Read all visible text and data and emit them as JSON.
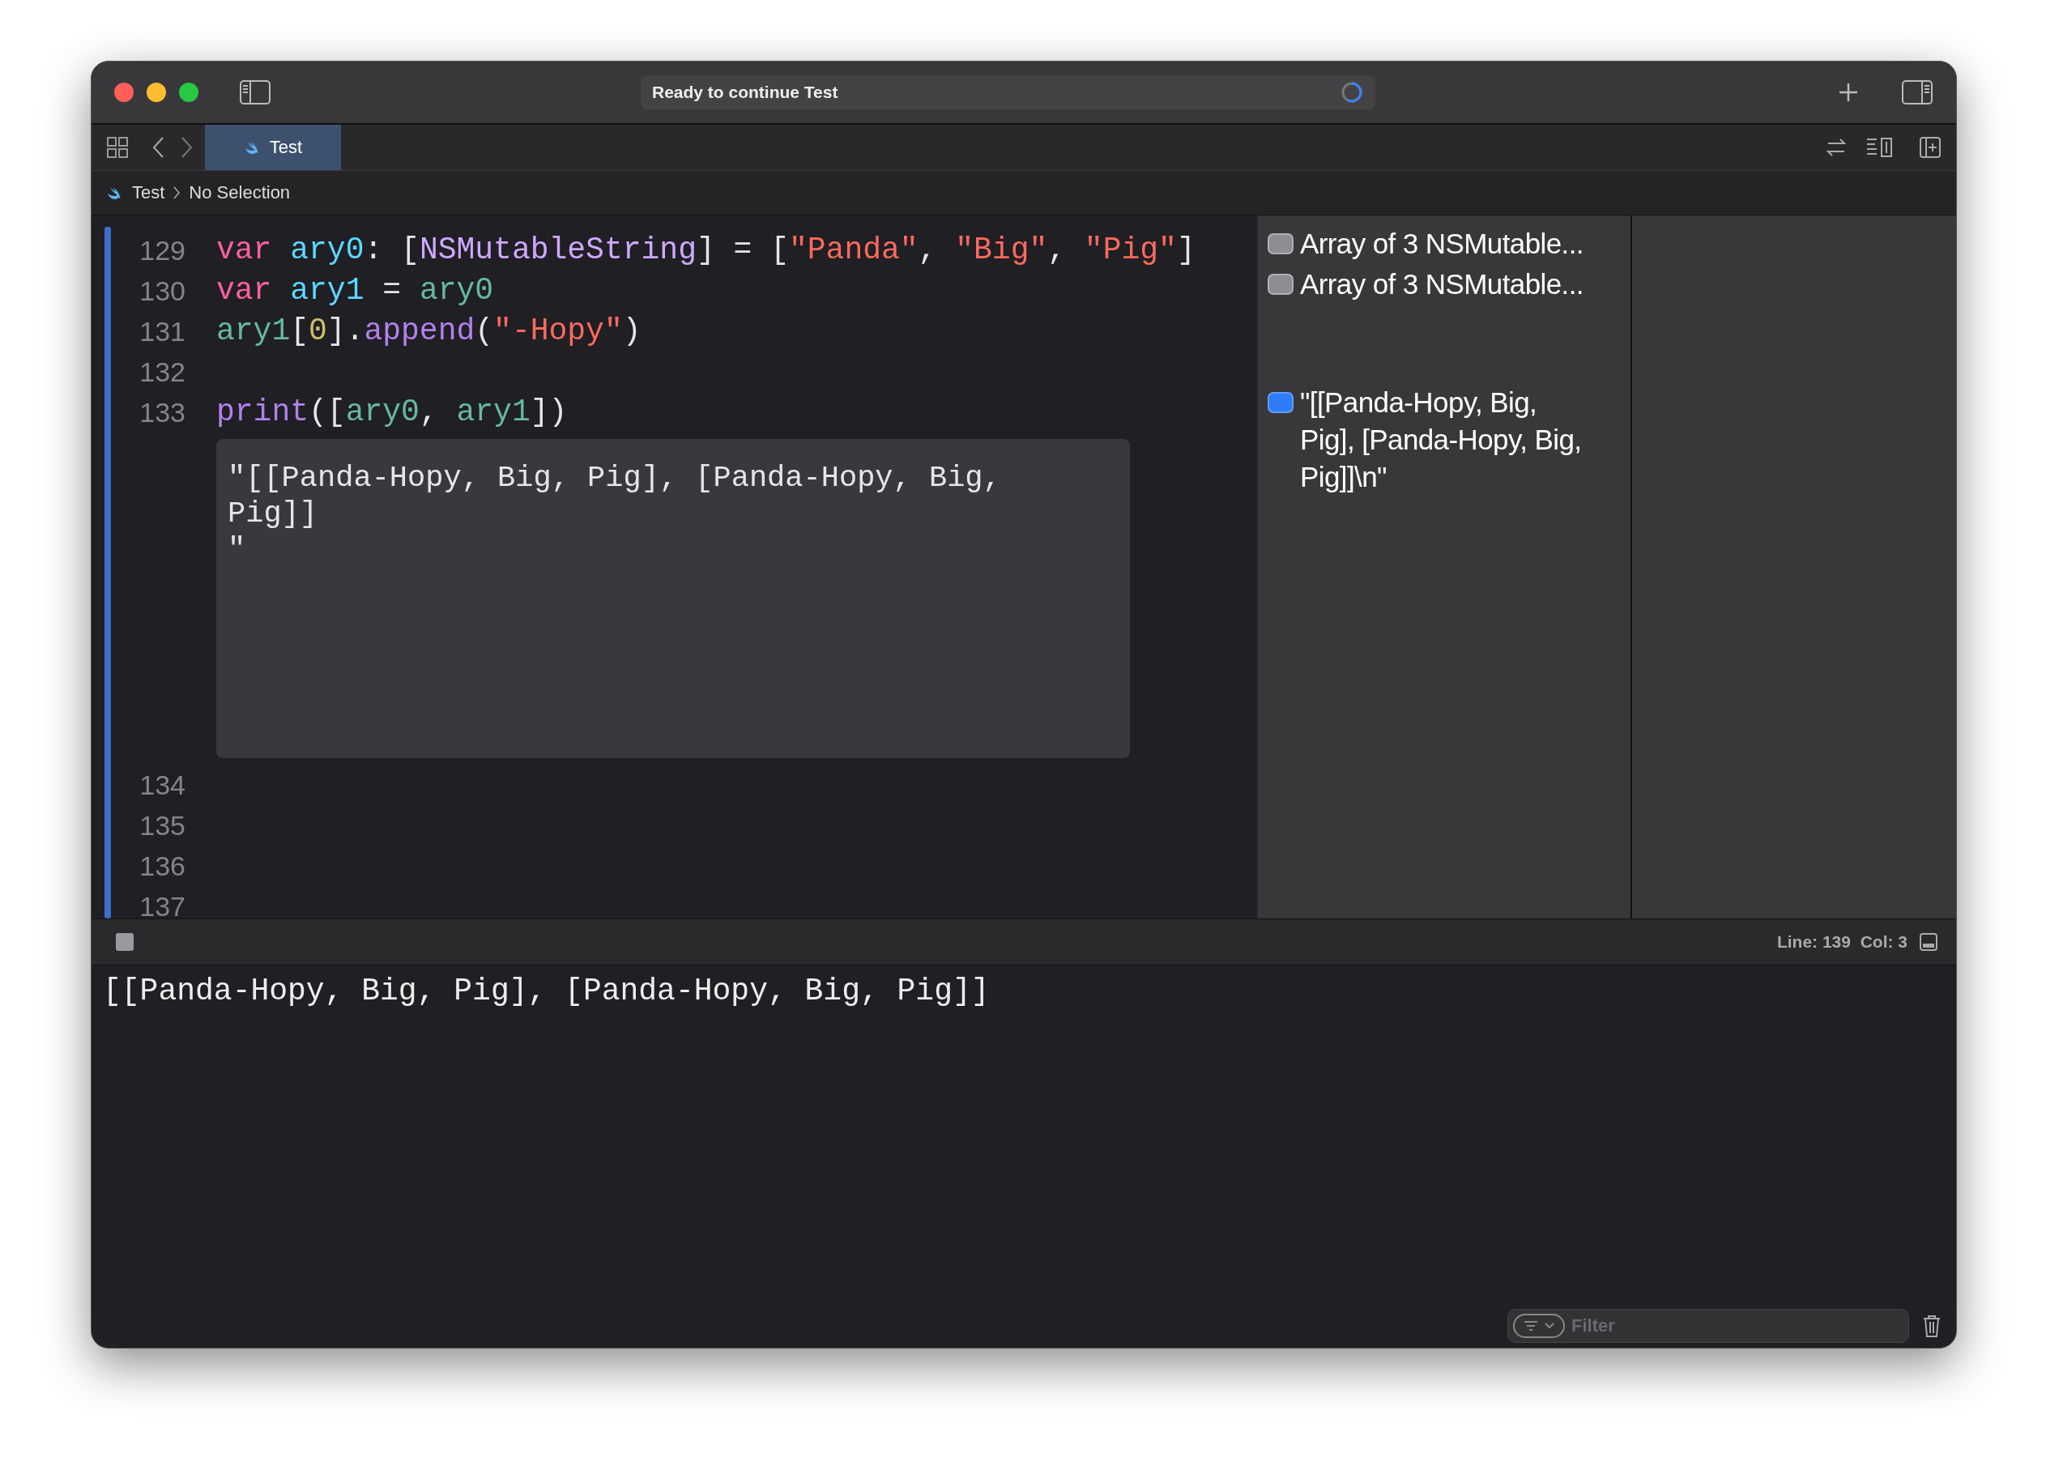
{
  "toolbar": {
    "activity": "Ready to continue Test"
  },
  "tabs": [
    {
      "label": "Test",
      "selected": true
    }
  ],
  "breadcrumb": [
    "Test",
    "No Selection"
  ],
  "code_lines": [
    {
      "number": "129",
      "tokens": [
        {
          "kind": "keyword",
          "text": "var"
        },
        {
          "kind": "decl",
          "text": " ary0"
        },
        {
          "kind": "plain",
          "text": ": ["
        },
        {
          "kind": "type",
          "text": "NSMutableString"
        },
        {
          "kind": "plain",
          "text": "] = ["
        },
        {
          "kind": "string",
          "text": "\"Panda\""
        },
        {
          "kind": "plain",
          "text": ", "
        },
        {
          "kind": "string",
          "text": "\"Big\""
        },
        {
          "kind": "plain",
          "text": ", "
        },
        {
          "kind": "string",
          "text": "\"Pig\""
        },
        {
          "kind": "plain",
          "text": "]"
        }
      ]
    },
    {
      "number": "130",
      "tokens": [
        {
          "kind": "keyword",
          "text": "var"
        },
        {
          "kind": "decl",
          "text": " ary1"
        },
        {
          "kind": "plain",
          "text": " = "
        },
        {
          "kind": "ident",
          "text": "ary0"
        }
      ]
    },
    {
      "number": "131",
      "tokens": [
        {
          "kind": "ident",
          "text": "ary1"
        },
        {
          "kind": "plain",
          "text": "["
        },
        {
          "kind": "number",
          "text": "0"
        },
        {
          "kind": "plain",
          "text": "]."
        },
        {
          "kind": "func",
          "text": "append"
        },
        {
          "kind": "plain",
          "text": "("
        },
        {
          "kind": "string",
          "text": "\"-Hopy\""
        },
        {
          "kind": "plain",
          "text": ")"
        }
      ]
    },
    {
      "number": "132"
    },
    {
      "number": "133",
      "tokens": [
        {
          "kind": "func",
          "text": "print"
        },
        {
          "kind": "plain",
          "text": "(["
        },
        {
          "kind": "ident",
          "text": "ary0"
        },
        {
          "kind": "plain",
          "text": ", "
        },
        {
          "kind": "ident",
          "text": "ary1"
        },
        {
          "kind": "plain",
          "text": "])"
        }
      ],
      "inline_result": "\"[[Panda-Hopy, Big, Pig], [Panda-Hopy, Big,\nPig]]\n\""
    },
    {
      "number": "134"
    },
    {
      "number": "135"
    },
    {
      "number": "136"
    },
    {
      "number": "137"
    }
  ],
  "results": [
    {
      "text": "Array of 3 NSMutable...",
      "selected": false
    },
    {
      "text": "Array of 3 NSMutable...",
      "selected": false
    },
    {
      "text": "\"[[Panda-Hopy, Big, Pig], [Panda-Hopy, Big, Pig]]\\n\"",
      "selected": true
    }
  ],
  "status": {
    "line": "Line: 139",
    "col": "Col: 3"
  },
  "console": {
    "output": "[[Panda-Hopy, Big, Pig], [Panda-Hopy, Big, Pig]]",
    "filter_placeholder": "Filter"
  }
}
